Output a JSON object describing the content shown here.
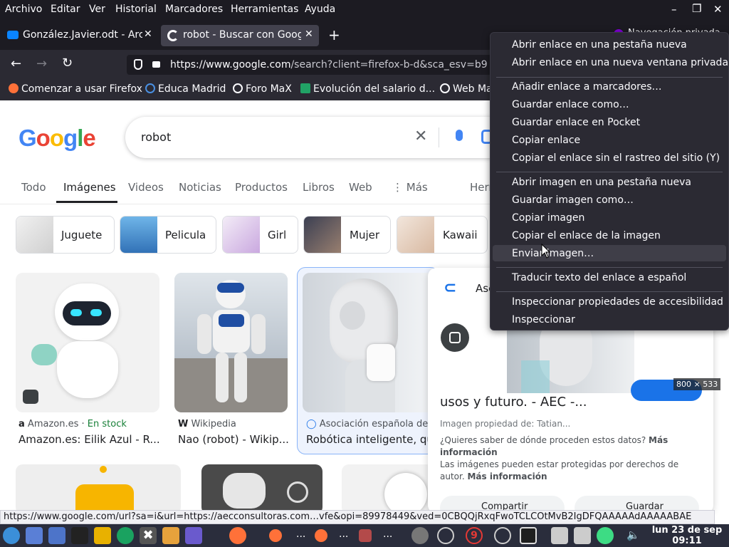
{
  "menubar": [
    "Archivo",
    "Editar",
    "Ver",
    "Historial",
    "Marcadores",
    "Herramientas",
    "Ayuda"
  ],
  "tabs": [
    {
      "title": "González.Javier.odt - Arc"
    },
    {
      "title": "robot - Buscar con Googl"
    }
  ],
  "private_label": "Navegación privada",
  "url": {
    "domain": "https://www.google.com",
    "path": "/search?client=firefox-b-d&sca_esv=b9"
  },
  "bookmarks": [
    "Comenzar a usar Firefox",
    "Educa Madrid",
    "Foro MaX",
    "Evolución del salario d...",
    "Web Ma"
  ],
  "search": {
    "query": "robot"
  },
  "gtabs": [
    "Todo",
    "Imágenes",
    "Videos",
    "Noticias",
    "Productos",
    "Libros",
    "Web",
    "Más",
    "Herr"
  ],
  "chips": [
    "Juguete",
    "Pelicula",
    "Girl",
    "Mujer",
    "Kawaii"
  ],
  "results": [
    {
      "source": "Amazon.es",
      "stock": "En stock",
      "title": "Amazon.es: Eilik Azul - R..."
    },
    {
      "source": "Wikipedia",
      "title": "Nao (robot) - Wikip..."
    },
    {
      "source": "Asociación española de e",
      "title": "Robótica inteligente, qué"
    }
  ],
  "panel": {
    "source": "Asc",
    "size": "800 × 533",
    "title": "usos y futuro. - AEC -...",
    "owner": "Imagen propiedad de: Tatian...",
    "q": "¿Quieres saber de dónde proceden estos datos?",
    "more": "Más información",
    "rights": "Las imágenes pueden estar protegidas por derechos de autor.",
    "more2": "Más información",
    "share": "Compartir",
    "save": "Guardar"
  },
  "context_menu": {
    "group1": [
      "Abrir enlace en una pestaña nueva",
      "Abrir enlace en una nueva ventana privada"
    ],
    "group2": [
      "Añadir enlace a marcadores…",
      "Guardar enlace como…",
      "Guardar enlace en Pocket",
      "Copiar enlace",
      "Copiar el enlace sin el rastreo del sitio (Y)"
    ],
    "group3": [
      "Abrir imagen en una pestaña nueva",
      "Guardar imagen como…",
      "Copiar imagen",
      "Copiar el enlace de la imagen",
      "Enviar imagen…"
    ],
    "group4": [
      "Traducir texto del enlace a español"
    ],
    "group5": [
      "Inspeccionar propiedades de accesibilidad",
      "Inspeccionar"
    ]
  },
  "statusbar": "https://www.google.com/url?sa=i&url=https://aecconsultoras.com…vfe&opi=89978449&ved=0CBQQjRxqFwoTCLCOtMvB2IgDFQAAAAAdAAAAABAE",
  "clock": {
    "date": "lun 23 de sep",
    "time": "09:11"
  },
  "taskbar_badge": "9",
  "icons": [
    "firefox-icon",
    "google-g-icon",
    "close-icon",
    "plus-icon",
    "back-icon",
    "forward-icon",
    "reload-icon",
    "shield-icon",
    "lock-icon",
    "mic-icon",
    "lens-icon",
    "clear-icon",
    "dots-icon",
    "tag-icon",
    "cursor-icon",
    "volume-icon",
    "monitor-icon",
    "folder-icon",
    "terminal-icon"
  ],
  "colors": {
    "firefox_dark": "#1c1b22",
    "toolbar": "#2b2a33",
    "google_blue": "#4285f4",
    "google_red": "#ea4335",
    "google_yellow": "#fbbc05",
    "google_green": "#34a853",
    "taskbar": "#2a2d3c"
  }
}
